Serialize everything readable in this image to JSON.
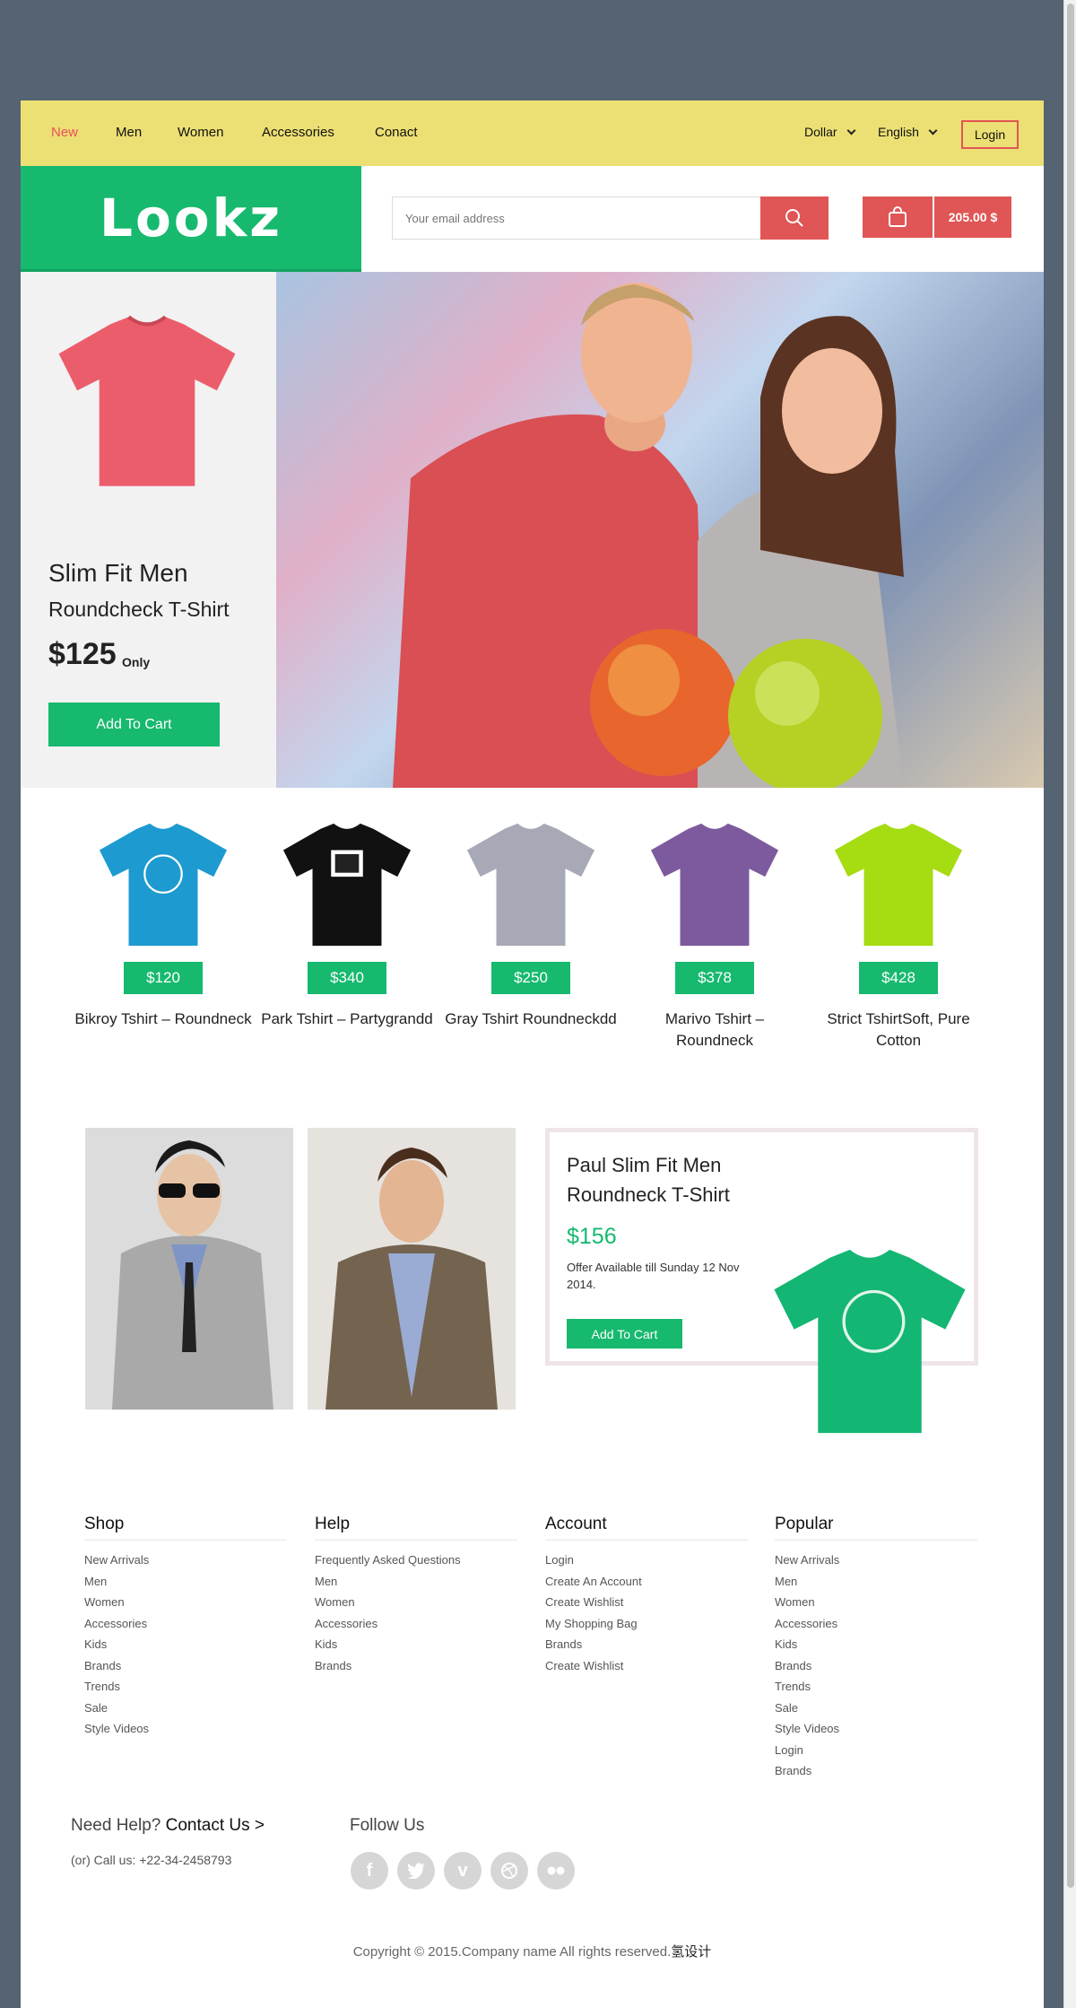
{
  "nav": {
    "links": [
      "New",
      "Men",
      "Women",
      "Accessories",
      "Conact"
    ],
    "currency": "Dollar",
    "language": "English",
    "login": "Login"
  },
  "header": {
    "logo": "Lookz",
    "email_placeholder": "Your email address",
    "cart_total": "205.00 $"
  },
  "hero": {
    "title_line1": "Slim Fit Men",
    "title_line2": "Roundcheck T-Shirt",
    "price": "$125",
    "price_suffix": "Only",
    "add_to_cart": "Add To Cart"
  },
  "products": [
    {
      "price": "$120",
      "name": "Bikroy Tshirt – Roundneck",
      "color": "#1d9ad0"
    },
    {
      "price": "$340",
      "name": "Park Tshirt – Partygrandd",
      "color": "#111111"
    },
    {
      "price": "$250",
      "name": "Gray Tshirt Roundneckdd",
      "color": "#a7a9b6"
    },
    {
      "price": "$378",
      "name": "Marivo Tshirt – Roundneck",
      "color": "#7d5a9e"
    },
    {
      "price": "$428",
      "name": "Strict TshirtSoft, Pure Cotton",
      "color": "#a5dc12"
    }
  ],
  "featured": {
    "title": "Paul Slim Fit Men Roundneck T-Shirt",
    "price": "$156",
    "offer": "Offer Available till Sunday 12 Nov 2014.",
    "add_to_cart": "Add To Cart",
    "shirt_color": "#13b672"
  },
  "footer": {
    "columns": [
      {
        "title": "Shop",
        "items": [
          "New Arrivals",
          "Men",
          "Women",
          "Accessories",
          "Kids",
          "Brands",
          "Trends",
          "Sale",
          "Style Videos"
        ]
      },
      {
        "title": "Help",
        "items": [
          "Frequently Asked Questions",
          "Men",
          "Women",
          "Accessories",
          "Kids",
          "Brands"
        ]
      },
      {
        "title": "Account",
        "items": [
          "Login",
          "Create An Account",
          "Create Wishlist",
          "My Shopping Bag",
          "Brands",
          "Create Wishlist"
        ]
      },
      {
        "title": "Popular",
        "items": [
          "New Arrivals",
          "Men",
          "Women",
          "Accessories",
          "Kids",
          "Brands",
          "Trends",
          "Sale",
          "Style Videos",
          "Login",
          "Brands"
        ]
      }
    ],
    "help_prefix": "Need Help?",
    "contact_link": "Contact Us >",
    "call": "(or) Call us: +22-34-2458793",
    "follow": "Follow Us",
    "socials": [
      "facebook-icon",
      "twitter-icon",
      "vimeo-icon",
      "dribbble-icon",
      "flickr-icon"
    ],
    "copyright": "Copyright © 2015.Company name All rights reserved.",
    "copyright_link": "氢设计"
  },
  "colors": {
    "accent_green": "#16b96e",
    "accent_red": "#e05555",
    "nav_yellow": "#ece074",
    "frame": "#556372"
  }
}
